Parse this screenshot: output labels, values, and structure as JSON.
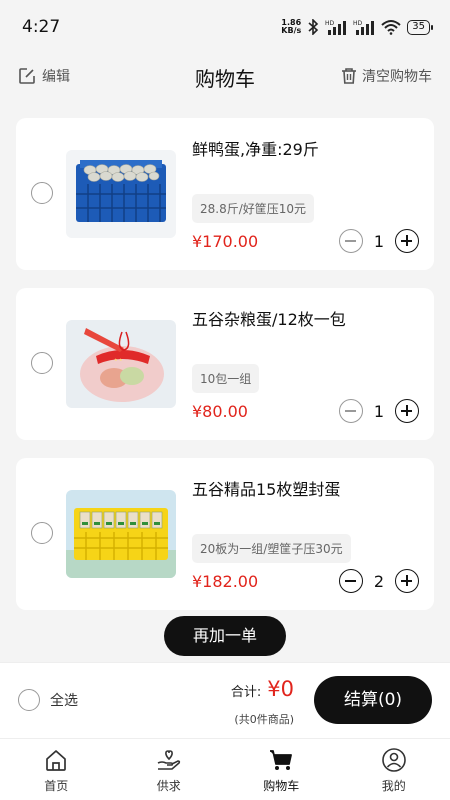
{
  "status_bar": {
    "time": "4:27",
    "net_speed": "1.86",
    "net_unit": "KB/s",
    "battery": "35"
  },
  "header": {
    "edit_label": "编辑",
    "title": "购物车",
    "clear_label": "清空购物车"
  },
  "items": [
    {
      "name": "鲜鸭蛋,净重:29斤",
      "spec": "28.8斤/好筐压10元",
      "price": "¥170.00",
      "qty": "1",
      "image": "duck-eggs-blue-crate"
    },
    {
      "name": "五谷杂粮蛋/12枚一包",
      "spec": "10包一组",
      "price": "¥80.00",
      "qty": "1",
      "image": "egg-pack-red-bag"
    },
    {
      "name": "五谷精品15枚塑封蛋",
      "spec": "20板为一组/塑筐子压30元",
      "price": "¥182.00",
      "qty": "2",
      "image": "sealed-eggs-yellow-crate"
    }
  ],
  "reorder_label": "再加一单",
  "footer": {
    "select_all": "全选",
    "total_label": "合计:",
    "total_amount": "¥0",
    "total_sub": "(共0件商品)",
    "checkout_label": "结算(0)"
  },
  "tabs": [
    {
      "label": "首页",
      "icon": "home-icon"
    },
    {
      "label": "供求",
      "icon": "hand-heart-icon"
    },
    {
      "label": "购物车",
      "icon": "cart-icon"
    },
    {
      "label": "我的",
      "icon": "user-icon"
    }
  ],
  "colors": {
    "price": "#e1241c",
    "primary": "#111111",
    "background": "#f4f4f4"
  }
}
